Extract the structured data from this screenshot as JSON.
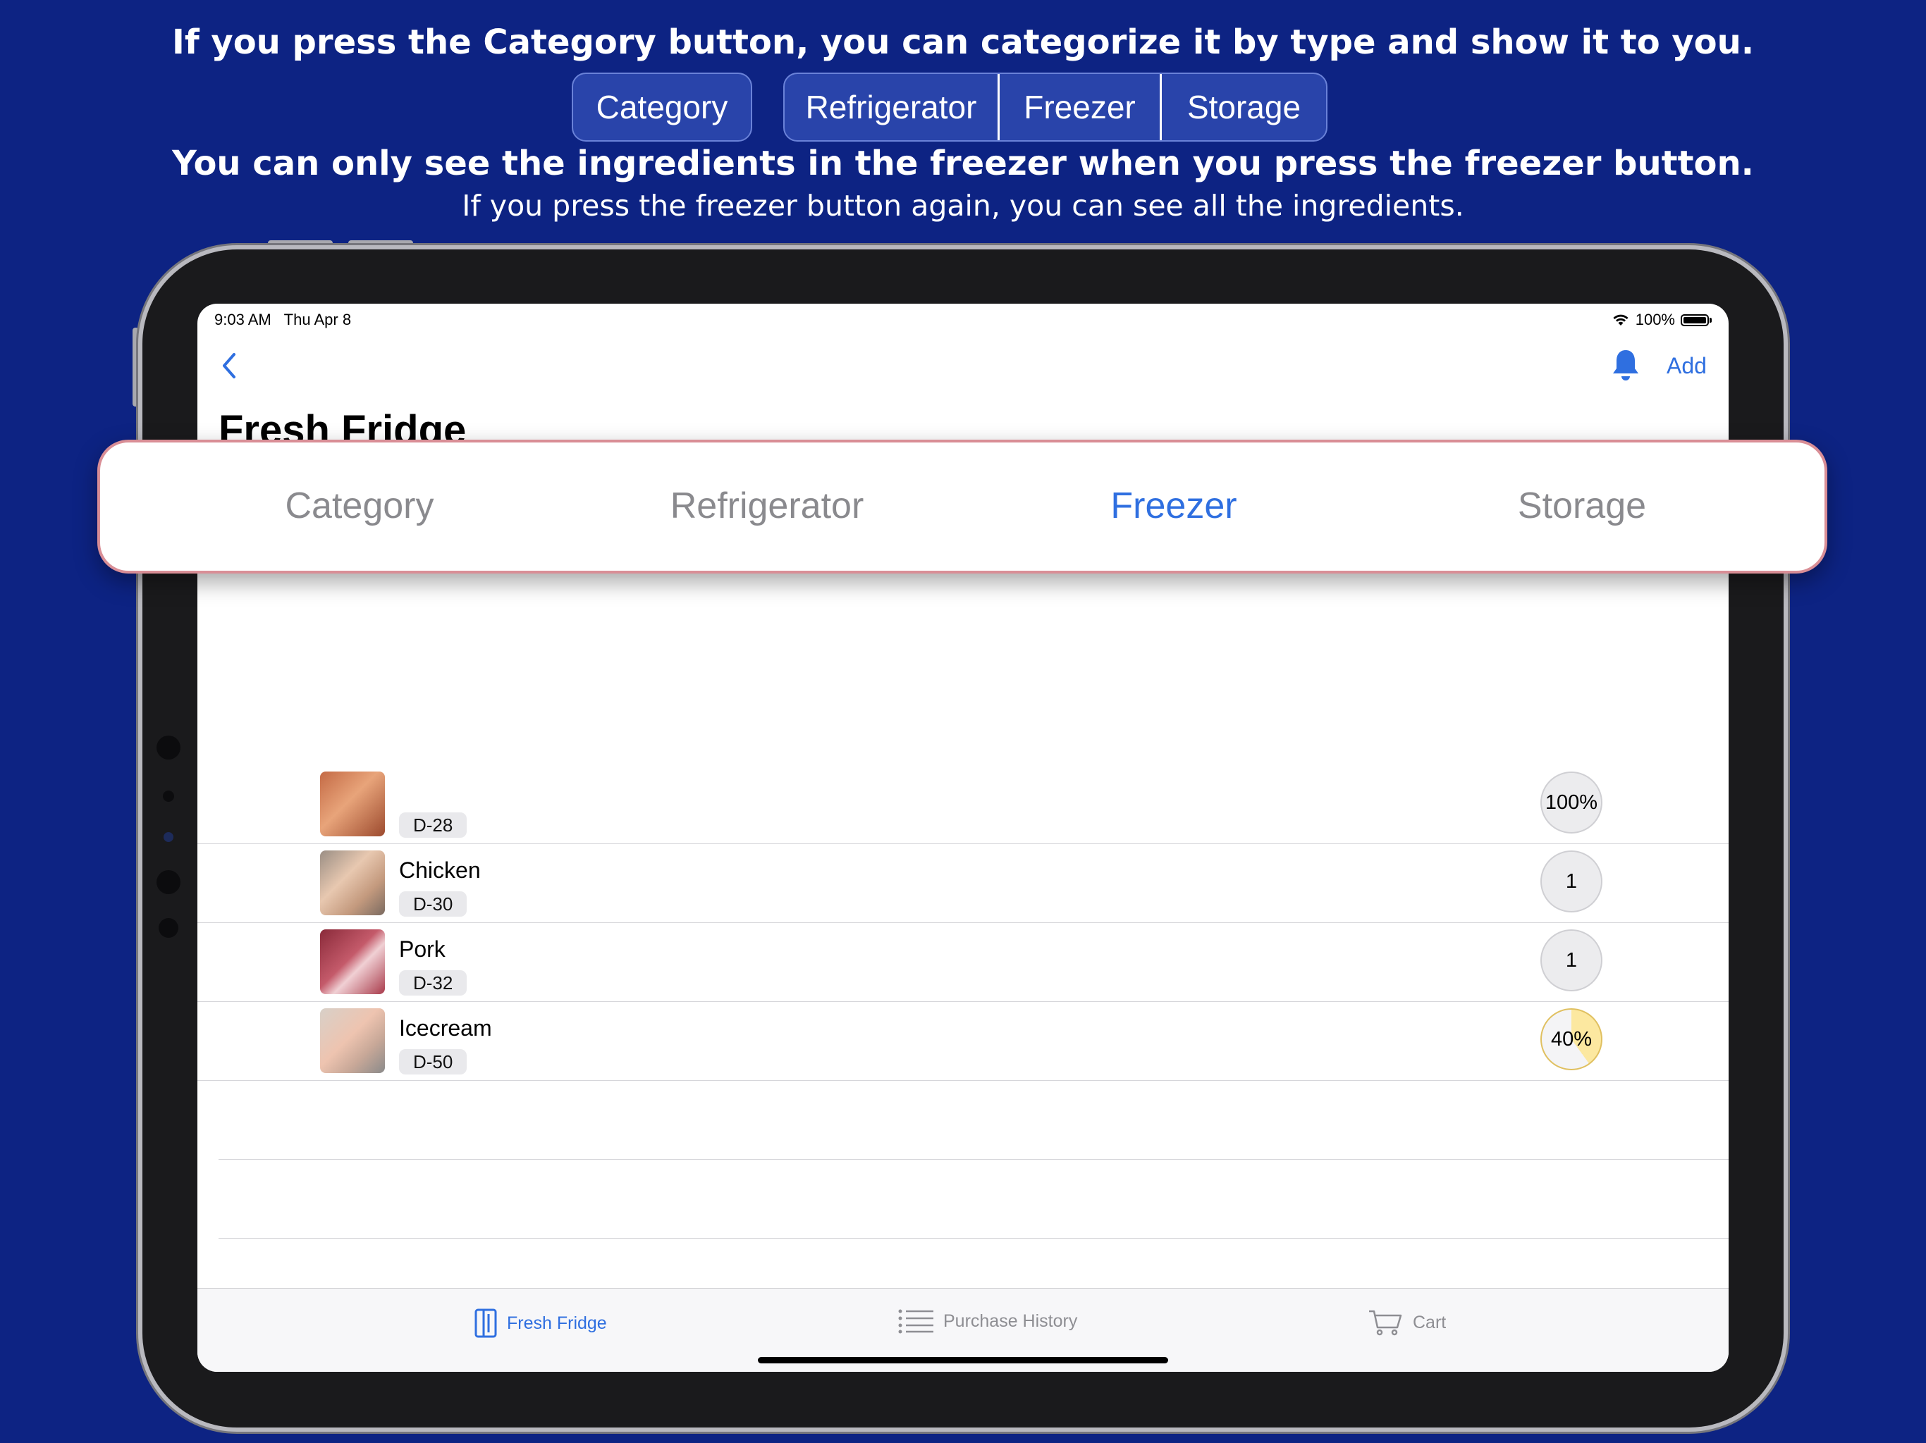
{
  "promo": {
    "line1": "If you press the Category button, you can categorize it by type and show it to you.",
    "category_label": "Category",
    "segments": [
      "Refrigerator",
      "Freezer",
      "Storage"
    ],
    "line2": "You can only see the ingredients in the freezer when you press the freezer button.",
    "line3": "If you press the freezer button again, you can see all the ingredients."
  },
  "status_bar": {
    "time": "9:03 AM",
    "date": "Thu Apr 8",
    "battery": "100%"
  },
  "nav": {
    "back_icon": "chevron-left-icon",
    "bell_icon": "bell-icon",
    "add_label": "Add",
    "title": "Fresh Fridge"
  },
  "filter_bar": {
    "items": [
      {
        "label": "Category",
        "active": false
      },
      {
        "label": "Refrigerator",
        "active": false
      },
      {
        "label": "Freezer",
        "active": true
      },
      {
        "label": "Storage",
        "active": false
      }
    ],
    "active_color": "#2f6fe0",
    "inactive_color": "#8a8a8e"
  },
  "items": [
    {
      "name": "",
      "dday": "D-28",
      "qty": "100%"
    },
    {
      "name": "Chicken",
      "dday": "D-30",
      "qty": "1"
    },
    {
      "name": "Pork",
      "dday": "D-32",
      "qty": "1"
    },
    {
      "name": "Icecream",
      "dday": "D-50",
      "qty": "40%",
      "fill": 0.4
    }
  ],
  "tabbar": {
    "tabs": [
      {
        "label": "Fresh Fridge",
        "icon": "fridge-icon",
        "active": true
      },
      {
        "label": "Purchase History",
        "icon": "list-icon",
        "active": false
      },
      {
        "label": "Cart",
        "icon": "cart-icon",
        "active": false
      }
    ]
  },
  "colors": {
    "background": "#0d2383",
    "accent": "#2f6fe0"
  }
}
